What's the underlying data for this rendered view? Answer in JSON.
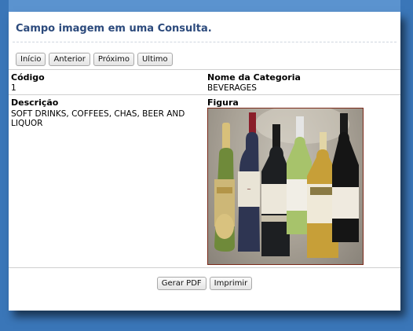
{
  "page": {
    "title": "Campo imagem em uma Consulta."
  },
  "nav": {
    "first": "Início",
    "previous": "Anterior",
    "next": "Próximo",
    "last": "Ultimo"
  },
  "record": {
    "code_label": "Código",
    "code_value": "1",
    "category_label": "Nome da Categoria",
    "category_value": "BEVERAGES",
    "description_label": "Descrição",
    "description_value": "SOFT DRINKS, COFFEES, CHAS, BEER AND LIQUOR",
    "figure_label": "Figura"
  },
  "footer": {
    "pdf_label": "Gerar PDF",
    "print_label": "Imprimir"
  },
  "colors": {
    "background": "#3a76b8",
    "title": "#2c4a7c"
  }
}
